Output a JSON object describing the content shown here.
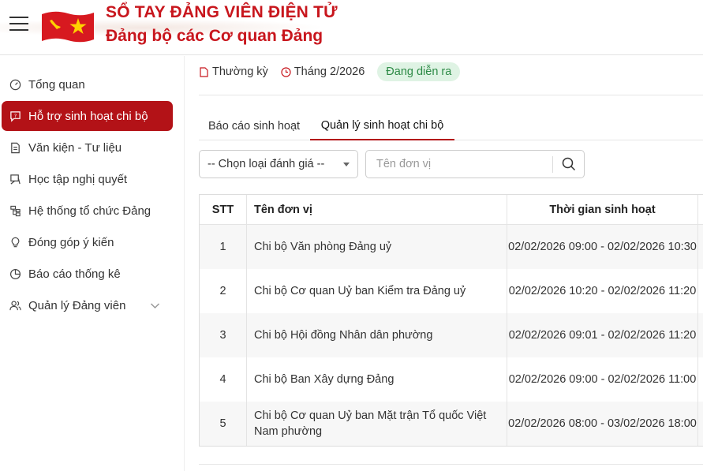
{
  "header": {
    "title_line1": "SỔ TAY ĐẢNG VIÊN ĐIỆN TỬ",
    "title_line2": "Đảng bộ các Cơ quan Đảng",
    "brand_color": "#c8161d"
  },
  "sidebar": {
    "items": [
      {
        "label": "Tổng quan",
        "icon": "dashboard-icon"
      },
      {
        "label": "Hỗ trợ sinh hoạt chi bộ",
        "icon": "help-chat-icon",
        "active": true
      },
      {
        "label": "Văn kiện - Tư liệu",
        "icon": "document-icon"
      },
      {
        "label": "Học tập nghị quyết",
        "icon": "study-icon"
      },
      {
        "label": "Hệ thống tổ chức Đảng",
        "icon": "org-chart-icon"
      },
      {
        "label": "Đóng góp ý kiến",
        "icon": "lightbulb-icon"
      },
      {
        "label": "Báo cáo thống kê",
        "icon": "pie-chart-icon"
      },
      {
        "label": "Quản lý Đảng viên",
        "icon": "users-icon",
        "has_submenu": true
      }
    ],
    "active_color": "#b31217"
  },
  "meta": {
    "type_label": "Thường kỳ",
    "month_label": "Tháng 2/2026",
    "status_badge": "Đang diễn ra",
    "status_color": "#2d8a46"
  },
  "tabs": [
    {
      "label": "Báo cáo sinh hoạt",
      "active": false
    },
    {
      "label": "Quản lý sinh hoạt chi bộ",
      "active": true
    }
  ],
  "filters": {
    "select_value": "-- Chọn loại đánh giá --",
    "search_placeholder": "Tên đơn vị"
  },
  "table": {
    "headers": {
      "stt": "STT",
      "name": "Tên đơn vị",
      "time": "Thời gian sinh hoạt"
    },
    "rows": [
      {
        "stt": "1",
        "name": "Chi bộ Văn phòng Đảng uỷ",
        "time": "02/02/2026 09:00 - 02/02/2026 10:30"
      },
      {
        "stt": "2",
        "name": "Chi bộ Cơ quan Uỷ ban Kiểm tra Đảng uỷ",
        "time": "02/02/2026 10:20 - 02/02/2026 11:20"
      },
      {
        "stt": "3",
        "name": "Chi bộ Hội đồng Nhân dân phường",
        "time": "02/02/2026 09:01 - 02/02/2026 11:20"
      },
      {
        "stt": "4",
        "name": "Chi bộ Ban Xây dựng Đảng",
        "time": "02/02/2026 09:00 - 02/02/2026 11:00"
      },
      {
        "stt": "5",
        "name": "Chi bộ Cơ quan Uỷ ban Mặt trận Tổ quốc Việt Nam phường",
        "time": "02/02/2026 08:00 - 03/02/2026 18:00"
      }
    ]
  }
}
